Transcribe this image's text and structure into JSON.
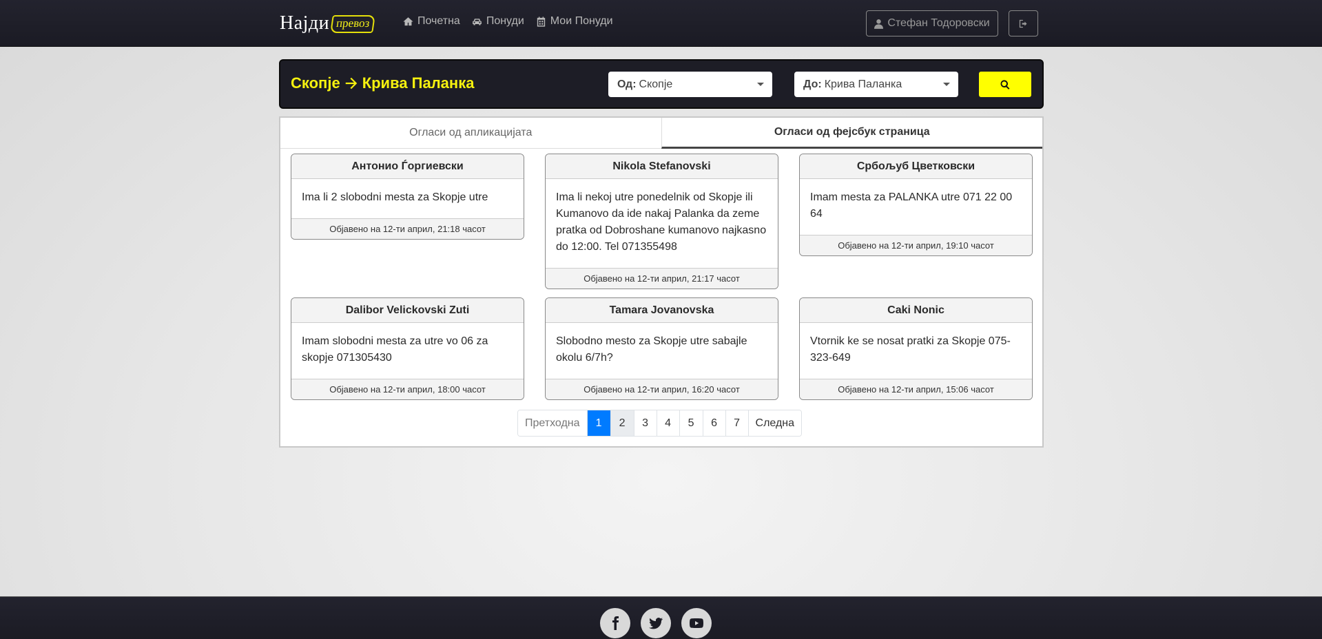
{
  "navbar": {
    "brand_word": "Најди",
    "brand_box": "превоз",
    "links": [
      {
        "label": "Почетна",
        "icon": "home-icon"
      },
      {
        "label": "Понуди",
        "icon": "car-icon"
      },
      {
        "label": "Мои Понуди",
        "icon": "calendar-icon"
      }
    ],
    "user_name": "Стефан Тодоровски",
    "logout_icon": "sign-out-icon"
  },
  "search": {
    "route_from": "Скопје",
    "route_to": "Крива Паланка",
    "from_label": "Од:",
    "from_value": "Скопје",
    "to_label": "До:",
    "to_value": "Крива Паланка",
    "search_icon": "search-icon",
    "accent_color": "#ffff00"
  },
  "tabs": [
    {
      "label": "Огласи од апликацијата",
      "active": false
    },
    {
      "label": "Огласи од фејсбук страница",
      "active": true
    }
  ],
  "cards": [
    {
      "author": "Антонио Ѓоргиевски",
      "text": "Ima li 2 slobodni mesta za Skopje utre",
      "posted": "Објавено на 12-ти април, 21:18 часот"
    },
    {
      "author": "Nikola Stefanovski",
      "text": "Ima li nekoj utre ponedelnik od Skopje ili Kumanovo da ide nakaj Palanka da zeme pratka od Dobroshane kumanovo najkasno do 12:00. Tel 071355498",
      "posted": "Објавено на 12-ти април, 21:17 часот"
    },
    {
      "author": "Србољуб Цветковски",
      "text": "Imam mesta za PALANKA utre 071 22 00 64",
      "posted": "Објавено на 12-ти април, 19:10 часот"
    },
    {
      "author": "Dalibor Velickovski Zuti",
      "text": "Imam slobodni mesta za utre vo 06 za skopje 071305430",
      "posted": "Објавено на 12-ти април, 18:00 часот"
    },
    {
      "author": "Tamara Jovanovska",
      "text": "Slobodno mesto za Skopje utre sabajle okolu 6/7h?",
      "posted": "Објавено на 12-ти април, 16:20 часот"
    },
    {
      "author": "Caki Nonic",
      "text": "Vtornik ke se nosat pratki za Skopje 075-323-649",
      "posted": "Објавено на 12-ти април, 15:06 часот"
    }
  ],
  "pagination": {
    "prev": "Претходна",
    "pages": [
      "1",
      "2",
      "3",
      "4",
      "5",
      "6",
      "7"
    ],
    "current": "1",
    "next": "Следна"
  },
  "footer": {
    "socials": [
      "facebook-icon",
      "twitter-icon",
      "youtube-icon"
    ]
  }
}
